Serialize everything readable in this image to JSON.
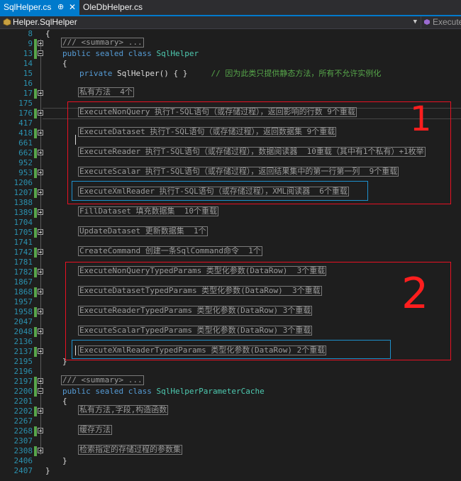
{
  "tabs": [
    {
      "label": "SqlHelper.cs",
      "active": true,
      "pin": "⊕",
      "close": "✕"
    },
    {
      "label": "OleDbHelper.cs",
      "active": false
    }
  ],
  "navbar": {
    "class_selector": "Helper.SqlHelper",
    "member_selector": "Execute"
  },
  "annotations": {
    "box1_label": "1",
    "box2_label": "2"
  },
  "lines": [
    {
      "num": "8",
      "fold": "",
      "indent": 0,
      "text": "{"
    },
    {
      "num": "9",
      "fold": "plus",
      "indent": 1,
      "collapsed": "/// <summary> ..."
    },
    {
      "num": "13",
      "fold": "minus",
      "indent": 1,
      "kw": "public sealed class",
      "type": "SqlHelper"
    },
    {
      "num": "14",
      "fold": "",
      "indent": 1,
      "text": "{"
    },
    {
      "num": "15",
      "fold": "",
      "indent": 2,
      "kw": "private",
      "code": "SqlHelper() { }",
      "comment": "// 因为此类只提供静态方法，所有不允许实例化"
    },
    {
      "num": "16",
      "fold": "",
      "indent": 0,
      "text": ""
    },
    {
      "num": "17",
      "fold": "plus",
      "indent": 2,
      "collapsed": "私有方法  4个"
    },
    {
      "num": "175",
      "fold": "",
      "indent": 0,
      "text": ""
    },
    {
      "num": "176",
      "fold": "plus",
      "indent": 2,
      "collapsed": "ExecuteNonQuery 执行T-SQL语句（或存储过程），返回影响的行数 9个重载"
    },
    {
      "num": "417",
      "fold": "",
      "indent": 0,
      "text": ""
    },
    {
      "num": "418",
      "fold": "plus",
      "indent": 2,
      "collapsed": "ExecuteDataset 执行T-SQL语句（或存储过程），返回数据集 9个重载"
    },
    {
      "num": "661",
      "fold": "",
      "indent": 0,
      "text": ""
    },
    {
      "num": "662",
      "fold": "plus",
      "indent": 2,
      "collapsed": "ExecuteReader 执行T-SQL语句（或存储过程），数据阅读器  10重载（其中有1个私有）+1枚举"
    },
    {
      "num": "952",
      "fold": "",
      "indent": 0,
      "text": ""
    },
    {
      "num": "953",
      "fold": "plus",
      "indent": 2,
      "collapsed": "ExecuteScalar 执行T-SQL语句（或存储过程），返回结果集中的第一行第一列  9个重载"
    },
    {
      "num": "1206",
      "fold": "",
      "indent": 0,
      "text": ""
    },
    {
      "num": "1207",
      "fold": "plus",
      "indent": 2,
      "collapsed": "ExecuteXmlReader 执行T-SQL语句（或存储过程），XML阅读器  6个重载"
    },
    {
      "num": "1388",
      "fold": "",
      "indent": 0,
      "text": ""
    },
    {
      "num": "1389",
      "fold": "plus",
      "indent": 2,
      "collapsed": "FillDataset 填充数据集  10个重载"
    },
    {
      "num": "1704",
      "fold": "",
      "indent": 0,
      "text": ""
    },
    {
      "num": "1705",
      "fold": "plus",
      "indent": 2,
      "collapsed": "UpdateDataset 更新数据集  1个"
    },
    {
      "num": "1741",
      "fold": "",
      "indent": 0,
      "text": ""
    },
    {
      "num": "1742",
      "fold": "plus",
      "indent": 2,
      "collapsed": "CreateCommand 创建一条SqlCommand命令  1个"
    },
    {
      "num": "1781",
      "fold": "",
      "indent": 0,
      "text": ""
    },
    {
      "num": "1782",
      "fold": "plus",
      "indent": 2,
      "collapsed": "ExecuteNonQueryTypedParams 类型化参数(DataRow)  3个重载"
    },
    {
      "num": "1867",
      "fold": "",
      "indent": 0,
      "text": ""
    },
    {
      "num": "1868",
      "fold": "plus",
      "indent": 2,
      "collapsed": "ExecuteDatasetTypedParams 类型化参数(DataRow)  3个重载"
    },
    {
      "num": "1957",
      "fold": "",
      "indent": 0,
      "text": ""
    },
    {
      "num": "1958",
      "fold": "plus",
      "indent": 2,
      "collapsed": "ExecuteReaderTypedParams 类型化参数(DataRow) 3个重载"
    },
    {
      "num": "2047",
      "fold": "",
      "indent": 0,
      "text": ""
    },
    {
      "num": "2048",
      "fold": "plus",
      "indent": 2,
      "collapsed": "ExecuteScalarTypedParams 类型化参数(DataRow) 3个重载"
    },
    {
      "num": "2136",
      "fold": "",
      "indent": 0,
      "text": ""
    },
    {
      "num": "2137",
      "fold": "plus",
      "indent": 2,
      "collapsed": "ExecuteXmlReaderTypedParams 类型化参数(DataRow) 2个重载"
    },
    {
      "num": "2195",
      "fold": "",
      "indent": 1,
      "text": "}"
    },
    {
      "num": "2196",
      "fold": "",
      "indent": 0,
      "text": ""
    },
    {
      "num": "2197",
      "fold": "plus",
      "indent": 1,
      "collapsed": "/// <summary> ..."
    },
    {
      "num": "2200",
      "fold": "minus",
      "indent": 1,
      "kw": "public sealed class",
      "type": "SqlHelperParameterCache"
    },
    {
      "num": "2201",
      "fold": "",
      "indent": 1,
      "text": "{"
    },
    {
      "num": "2202",
      "fold": "plus",
      "indent": 2,
      "collapsed": "私有方法,字段,构造函数"
    },
    {
      "num": "2267",
      "fold": "",
      "indent": 0,
      "text": ""
    },
    {
      "num": "2268",
      "fold": "plus",
      "indent": 2,
      "collapsed": "缓存方法"
    },
    {
      "num": "2307",
      "fold": "",
      "indent": 0,
      "text": ""
    },
    {
      "num": "2308",
      "fold": "plus",
      "indent": 2,
      "collapsed": "检索指定的存储过程的参数集"
    },
    {
      "num": "2406",
      "fold": "",
      "indent": 1,
      "text": "}"
    },
    {
      "num": "2407",
      "fold": "",
      "indent": 0,
      "text": "}"
    }
  ]
}
